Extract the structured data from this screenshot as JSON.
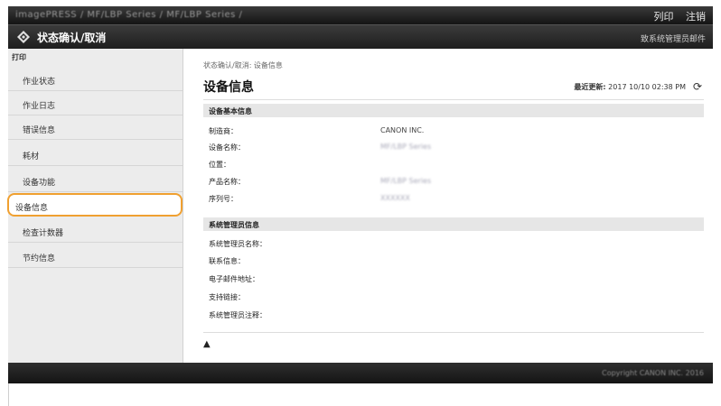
{
  "topbar": {
    "breadcrumb": "imagePRESS  /  MF/LBP Series  /  MF/LBP Series  /",
    "print_label": "列印",
    "logout_label": "注销"
  },
  "header": {
    "title": "状态确认/取消",
    "mail_label": "致系统管理员邮件"
  },
  "sidebar": {
    "caption": "打印",
    "items": [
      {
        "label": "作业状态"
      },
      {
        "label": "作业日志"
      },
      {
        "label": "错误信息"
      },
      {
        "label": "耗材"
      },
      {
        "label": "设备功能"
      },
      {
        "label": "设备信息"
      },
      {
        "label": "检查计数器"
      },
      {
        "label": "节约信息"
      }
    ],
    "selected_index": 5
  },
  "main": {
    "breadcrumb": "状态确认/取消: 设备信息",
    "title": "设备信息",
    "updated_label": "最近更新:",
    "updated_value": "2017 10/10 02:38 PM",
    "section1": {
      "title": "设备基本信息",
      "rows": [
        {
          "label": "制造商：",
          "value": "CANON INC."
        },
        {
          "label": "设备名称：",
          "value": "MF/LBP Series"
        },
        {
          "label": "位置：",
          "value": ""
        },
        {
          "label": "产品名称：",
          "value": "MF/LBP Series"
        },
        {
          "label": "序列号：",
          "value": "XXXXXX"
        }
      ]
    },
    "section2": {
      "title": "系统管理员信息",
      "rows": [
        {
          "label": "系统管理员名称："
        },
        {
          "label": "联系信息："
        },
        {
          "label": "电子邮件地址："
        },
        {
          "label": "支持链接："
        },
        {
          "label": "系统管理员注释："
        }
      ]
    },
    "to_top_label": "▲"
  },
  "footer": {
    "copyright": "Copyright CANON INC. 2016"
  },
  "colors": {
    "highlight": "#f0a030",
    "header_dark": "#1d1d1d",
    "sidebar_bg": "#ececec"
  }
}
